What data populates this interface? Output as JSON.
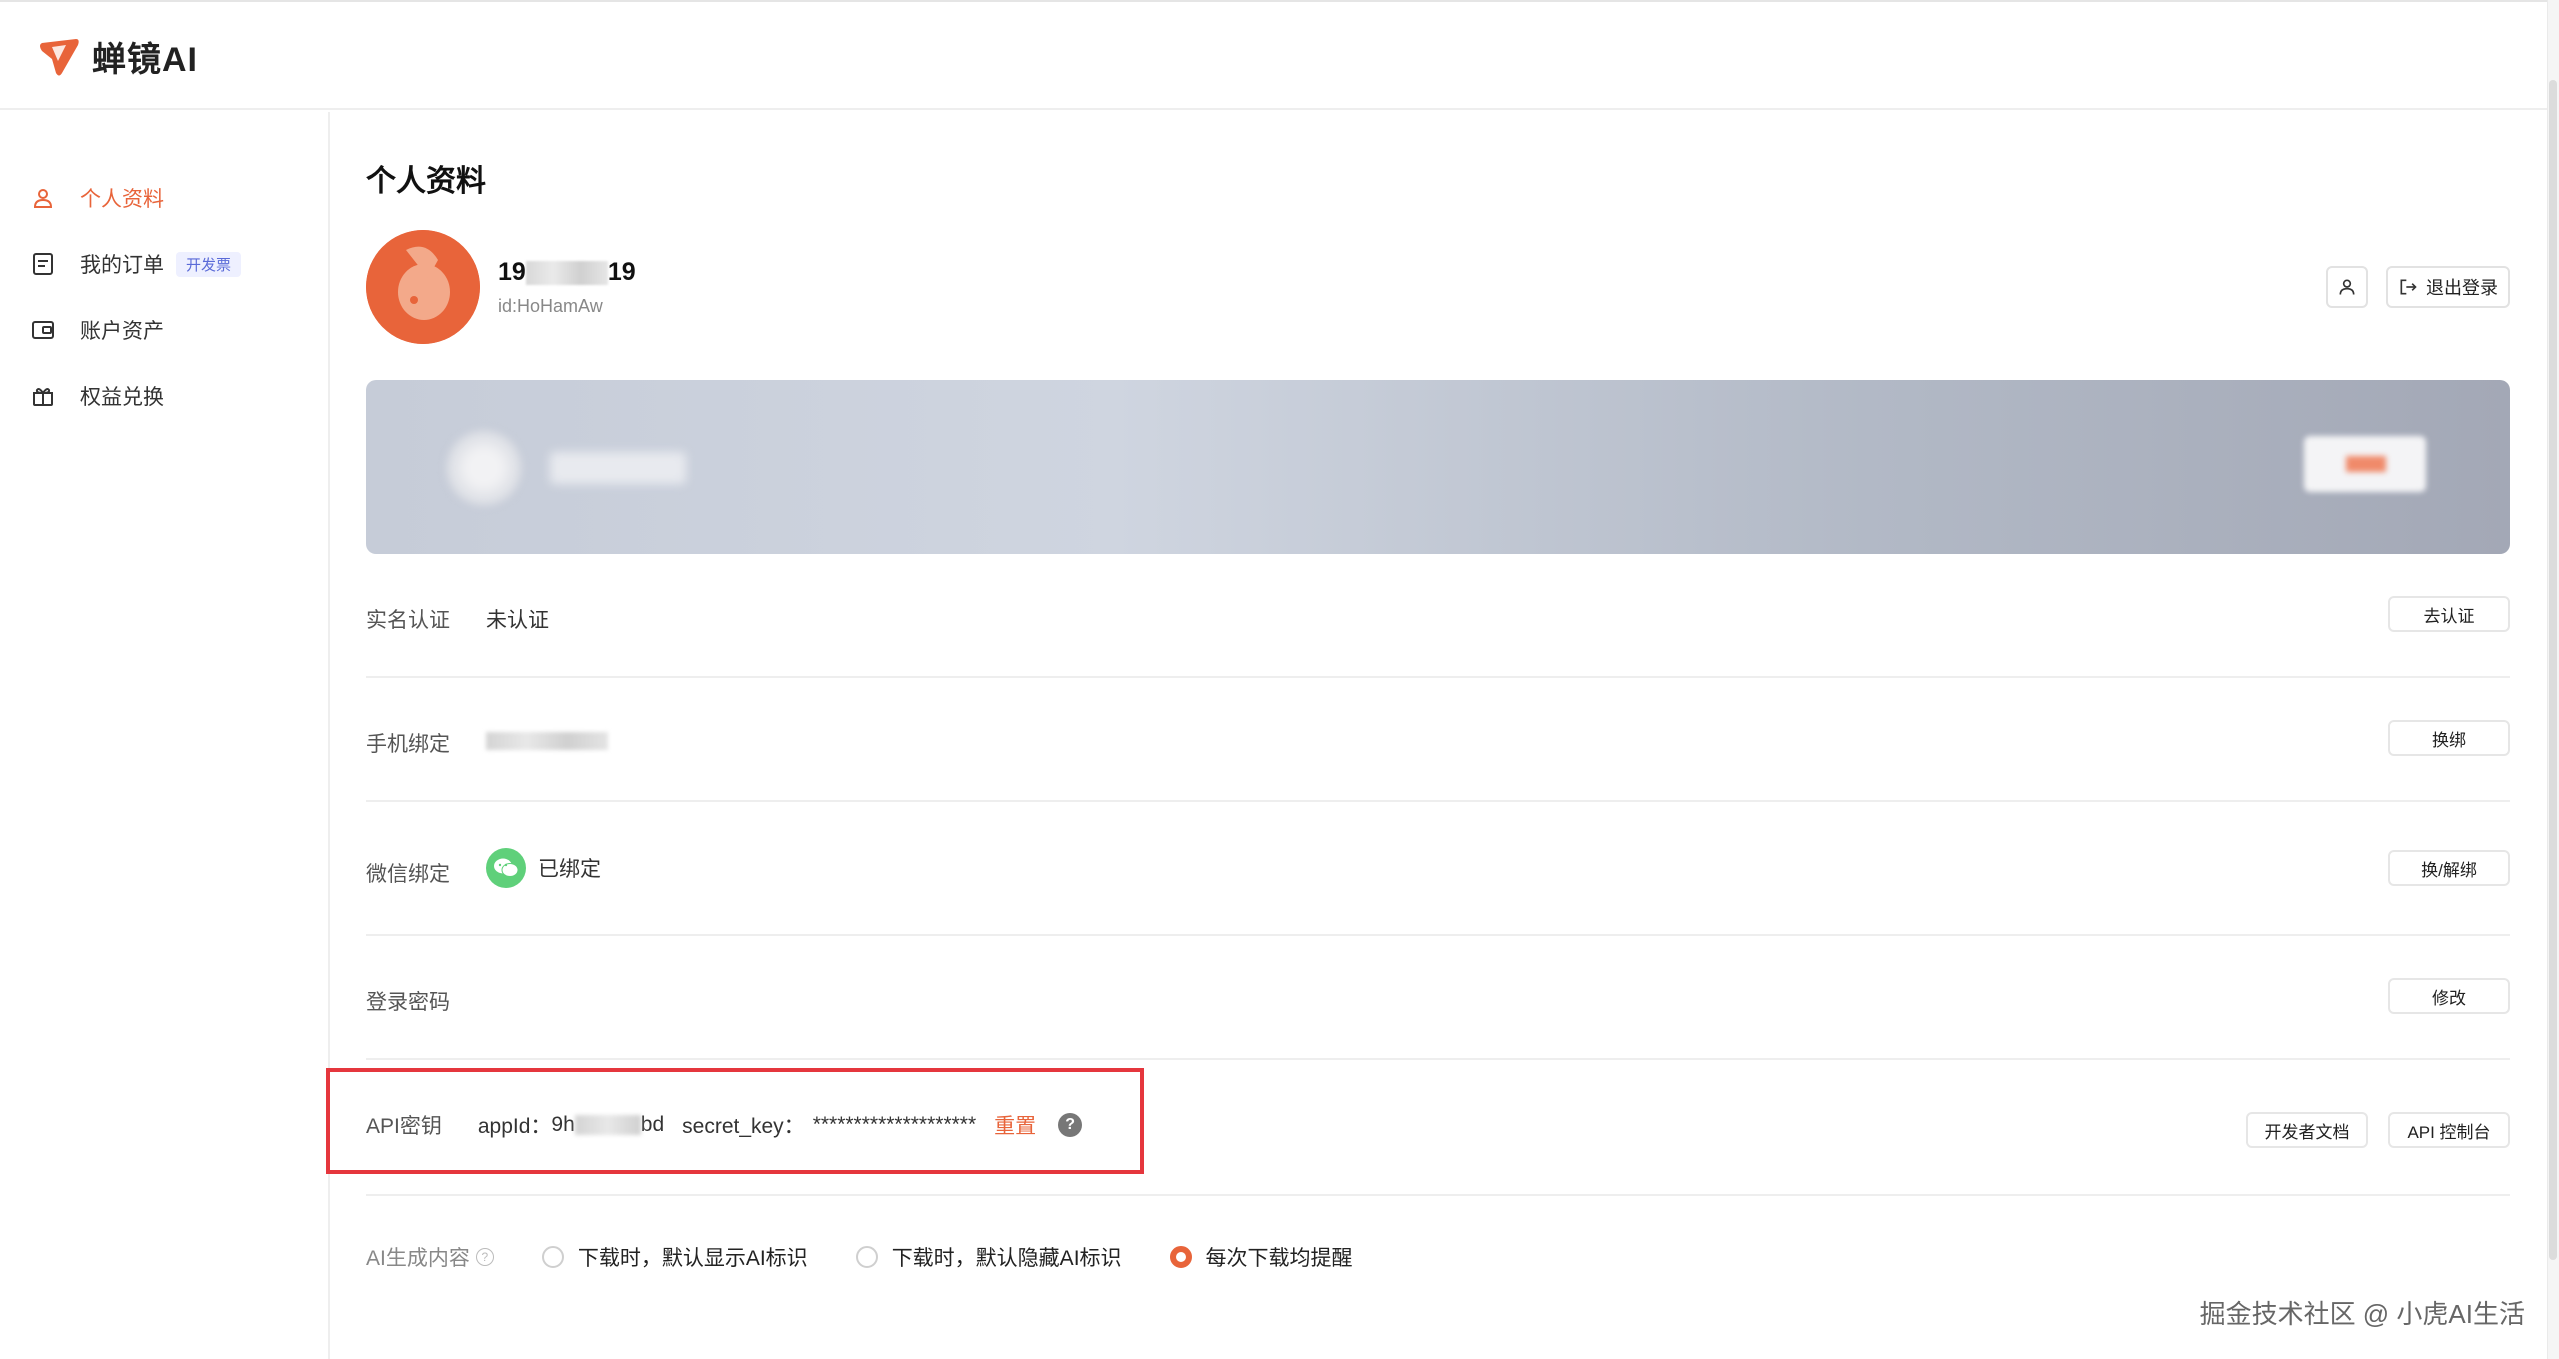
{
  "header": {
    "brand": "蝉镜AI"
  },
  "sidebar": {
    "items": [
      {
        "label": "个人资料",
        "icon": "user-icon"
      },
      {
        "label": "我的订单",
        "icon": "order-icon",
        "badge": "开发票"
      },
      {
        "label": "账户资产",
        "icon": "wallet-icon"
      },
      {
        "label": "权益兑换",
        "icon": "gift-icon"
      }
    ]
  },
  "main": {
    "title": "个人资料",
    "user": {
      "name_prefix": "19",
      "name_suffix": "19",
      "id": "id:HoHamAw"
    },
    "logout_label": "退出登录",
    "rows": {
      "realname": {
        "label": "实名认证",
        "value": "未认证",
        "button": "去认证"
      },
      "phone": {
        "label": "手机绑定",
        "button": "换绑"
      },
      "wechat": {
        "label": "微信绑定",
        "value": "已绑定",
        "button": "换/解绑"
      },
      "password": {
        "label": "登录密码",
        "button": "修改"
      },
      "api": {
        "label": "API密钥",
        "appid_label": "appId：",
        "appid_prefix": "9h",
        "appid_suffix": "bd",
        "secret_label": "secret_key：",
        "secret_value": "********************",
        "reset": "重置",
        "help": "?",
        "dev_docs": "开发者文档",
        "console": "API 控制台"
      },
      "ai": {
        "label": "AI生成内容",
        "help": "?",
        "options": [
          "下载时，默认显示AI标识",
          "下载时，默认隐藏AI标识",
          "每次下载均提醒"
        ],
        "selected_index": 2
      }
    }
  },
  "watermark": "掘金技术社区 @ 小虎AI生活",
  "colors": {
    "accent": "#e8643a",
    "highlight_border": "#e5363d",
    "wechat": "#5fd07a"
  }
}
